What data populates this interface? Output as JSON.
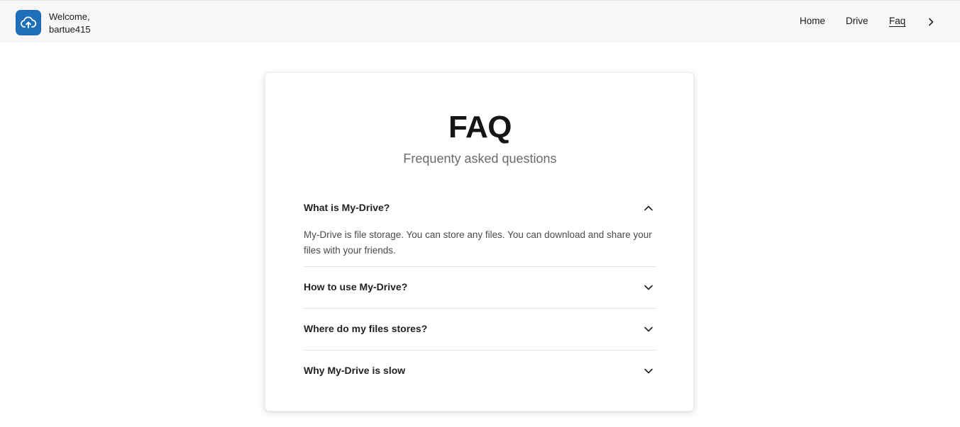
{
  "header": {
    "logo_icon": "cloud-upload-icon",
    "welcome_line1": "Welcome,",
    "username": "bartue415",
    "nav": [
      {
        "label": "Home"
      },
      {
        "label": "Drive"
      },
      {
        "label": "Faq"
      }
    ],
    "active_nav": "Faq",
    "expand_icon": "chevron-right-icon"
  },
  "faq": {
    "title": "FAQ",
    "subtitle": "Frequenty asked questions",
    "items": [
      {
        "question": "What is My-Drive?",
        "expanded": true,
        "answer": "My-Drive is file storage. You can store any files. You can download and share your files with your friends."
      },
      {
        "question": "How to use My-Drive?",
        "expanded": false
      },
      {
        "question": "Where do my files stores?",
        "expanded": false
      },
      {
        "question": "Why My-Drive is slow",
        "expanded": false
      }
    ]
  },
  "colors": {
    "brand": "#1f6fb8",
    "topbar_bg": "#f7f7f7"
  }
}
